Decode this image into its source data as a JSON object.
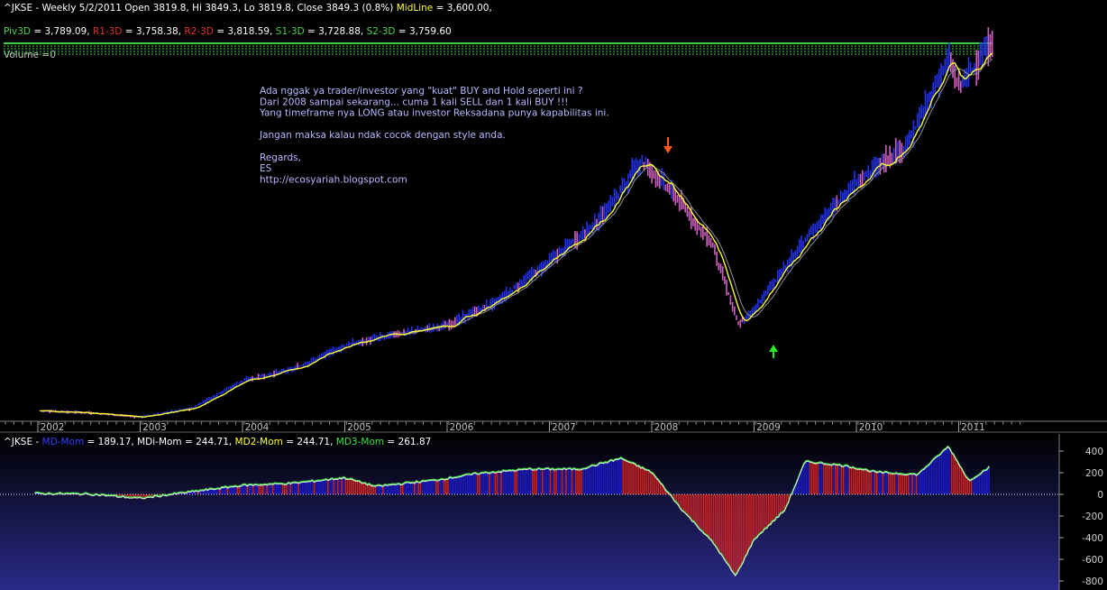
{
  "header": {
    "title": "^JKSE - Weekly 5/2/2011 Open 3819.8, Hi 3849.3, Lo 3819.8, Close 3849.3 (0.8%)",
    "midline_label": "MidLine",
    "midline_value": " = 3,600.00,",
    "pivots": [
      {
        "label": "Piv3D",
        "value": " = 3,789.09,",
        "color": "#4ad24a"
      },
      {
        "label": "R1-3D",
        "value": " = 3,758.38,",
        "color": "#e03030"
      },
      {
        "label": "R2-3D",
        "value": " = 3,818.59,",
        "color": "#e03030"
      },
      {
        "label": "S1-3D",
        "value": " = 3,728.88,",
        "color": "#4ad24a"
      },
      {
        "label": "S2-3D",
        "value": " = 3,759.60",
        "color": "#4ad24a"
      }
    ],
    "volume": "Volume =0"
  },
  "annotation": [
    "Ada nggak ya trader/investor yang \"kuat\" BUY and Hold seperti ini ?",
    "Dari 2008 sampai sekarang... cuma 1 kali SELL dan 1 kali BUY !!!",
    "Yang timeframe nya LONG atau investor Reksadana punya kapabilitas ini.",
    "",
    "Jangan maksa kalau ndak cocok dengan style anda.",
    "",
    "Regards,",
    "ES",
    "http://ecosyariah.blogspot.com"
  ],
  "years": [
    "2002",
    "2003",
    "2004",
    "2005",
    "2006",
    "2007",
    "2008",
    "2009",
    "2010",
    "2011"
  ],
  "mom_header": {
    "prefix": "^JKSE - ",
    "items": [
      {
        "label": "MD-Mom",
        "value": " = 189.17, ",
        "color": "#3040ff"
      },
      {
        "label": "MDi-Mom",
        "value": " = 244.71, ",
        "color": "#ffffff"
      },
      {
        "label": "MD2-Mom",
        "value": " = 244.71, ",
        "color": "#ffff30"
      },
      {
        "label": "MD3-Mom",
        "value": " = 261.87",
        "color": "#40e040"
      }
    ]
  },
  "colors": {
    "up_bar": "#2233ee",
    "down_bar": "#d060c0",
    "midline_ma": "#ffff33",
    "slow_ma": "#909090",
    "mom_positive": "#1a1acc",
    "mom_negative": "#cc2222",
    "sell_arrow": "#ff5a1e",
    "buy_arrow": "#22ee22"
  },
  "chart_data": [
    {
      "type": "bar",
      "title": "^JKSE - Weekly",
      "ylim": [
        300,
        3900
      ],
      "x_ticks": [
        "2002",
        "2003",
        "2004",
        "2005",
        "2006",
        "2007",
        "2008",
        "2009",
        "2010",
        "2011"
      ],
      "series": [
        {
          "name": "MidLine",
          "value": 3600.0
        }
      ],
      "close_path": [
        {
          "x": 2002.0,
          "y": 400
        },
        {
          "x": 2002.5,
          "y": 380
        },
        {
          "x": 2003.0,
          "y": 340
        },
        {
          "x": 2003.5,
          "y": 420
        },
        {
          "x": 2004.0,
          "y": 680
        },
        {
          "x": 2004.5,
          "y": 790
        },
        {
          "x": 2005.0,
          "y": 1010
        },
        {
          "x": 2005.5,
          "y": 1120
        },
        {
          "x": 2006.0,
          "y": 1200
        },
        {
          "x": 2006.5,
          "y": 1430
        },
        {
          "x": 2007.0,
          "y": 1800
        },
        {
          "x": 2007.5,
          "y": 2200
        },
        {
          "x": 2007.9,
          "y": 2750
        },
        {
          "x": 2008.2,
          "y": 2450
        },
        {
          "x": 2008.6,
          "y": 1950
        },
        {
          "x": 2008.85,
          "y": 1200
        },
        {
          "x": 2009.0,
          "y": 1350
        },
        {
          "x": 2009.5,
          "y": 2000
        },
        {
          "x": 2010.0,
          "y": 2550
        },
        {
          "x": 2010.5,
          "y": 2900
        },
        {
          "x": 2010.9,
          "y": 3700
        },
        {
          "x": 2011.0,
          "y": 3450
        },
        {
          "x": 2011.33,
          "y": 3849.3
        }
      ],
      "last_bar": {
        "open": 3819.8,
        "high": 3849.3,
        "low": 3819.8,
        "close": 3849.3,
        "change": "0.8%"
      },
      "pivots": {
        "Piv3D": 3789.09,
        "R1-3D": 3758.38,
        "R2-3D": 3818.59,
        "S1-3D": 3728.88,
        "S2-3D": 3759.6
      }
    },
    {
      "type": "bar",
      "title": "^JKSE - MD-Mom",
      "ylim": [
        -850,
        450
      ],
      "y_ticks": [
        400,
        200,
        0,
        -200,
        -400,
        -600,
        -800
      ],
      "series": [
        {
          "name": "MD-Mom",
          "last": 189.17
        },
        {
          "name": "MDi-Mom",
          "last": 244.71
        },
        {
          "name": "MD2-Mom",
          "last": 244.71
        },
        {
          "name": "MD3-Mom",
          "last": 261.87
        }
      ],
      "mom_path": [
        {
          "x": 2001.95,
          "y": 5
        },
        {
          "x": 2002.5,
          "y": 0
        },
        {
          "x": 2003.0,
          "y": -40
        },
        {
          "x": 2003.5,
          "y": 20
        },
        {
          "x": 2004.0,
          "y": 80
        },
        {
          "x": 2004.5,
          "y": 100
        },
        {
          "x": 2005.0,
          "y": 150
        },
        {
          "x": 2005.3,
          "y": 70
        },
        {
          "x": 2005.9,
          "y": 130
        },
        {
          "x": 2006.3,
          "y": 190
        },
        {
          "x": 2006.8,
          "y": 230
        },
        {
          "x": 2007.3,
          "y": 230
        },
        {
          "x": 2007.7,
          "y": 330
        },
        {
          "x": 2008.0,
          "y": 200
        },
        {
          "x": 2008.3,
          "y": -150
        },
        {
          "x": 2008.6,
          "y": -450
        },
        {
          "x": 2008.82,
          "y": -760
        },
        {
          "x": 2009.0,
          "y": -420
        },
        {
          "x": 2009.3,
          "y": -150
        },
        {
          "x": 2009.5,
          "y": 300
        },
        {
          "x": 2009.9,
          "y": 260
        },
        {
          "x": 2010.2,
          "y": 200
        },
        {
          "x": 2010.6,
          "y": 180
        },
        {
          "x": 2010.9,
          "y": 440
        },
        {
          "x": 2011.1,
          "y": 120
        },
        {
          "x": 2011.3,
          "y": 250
        }
      ]
    }
  ]
}
